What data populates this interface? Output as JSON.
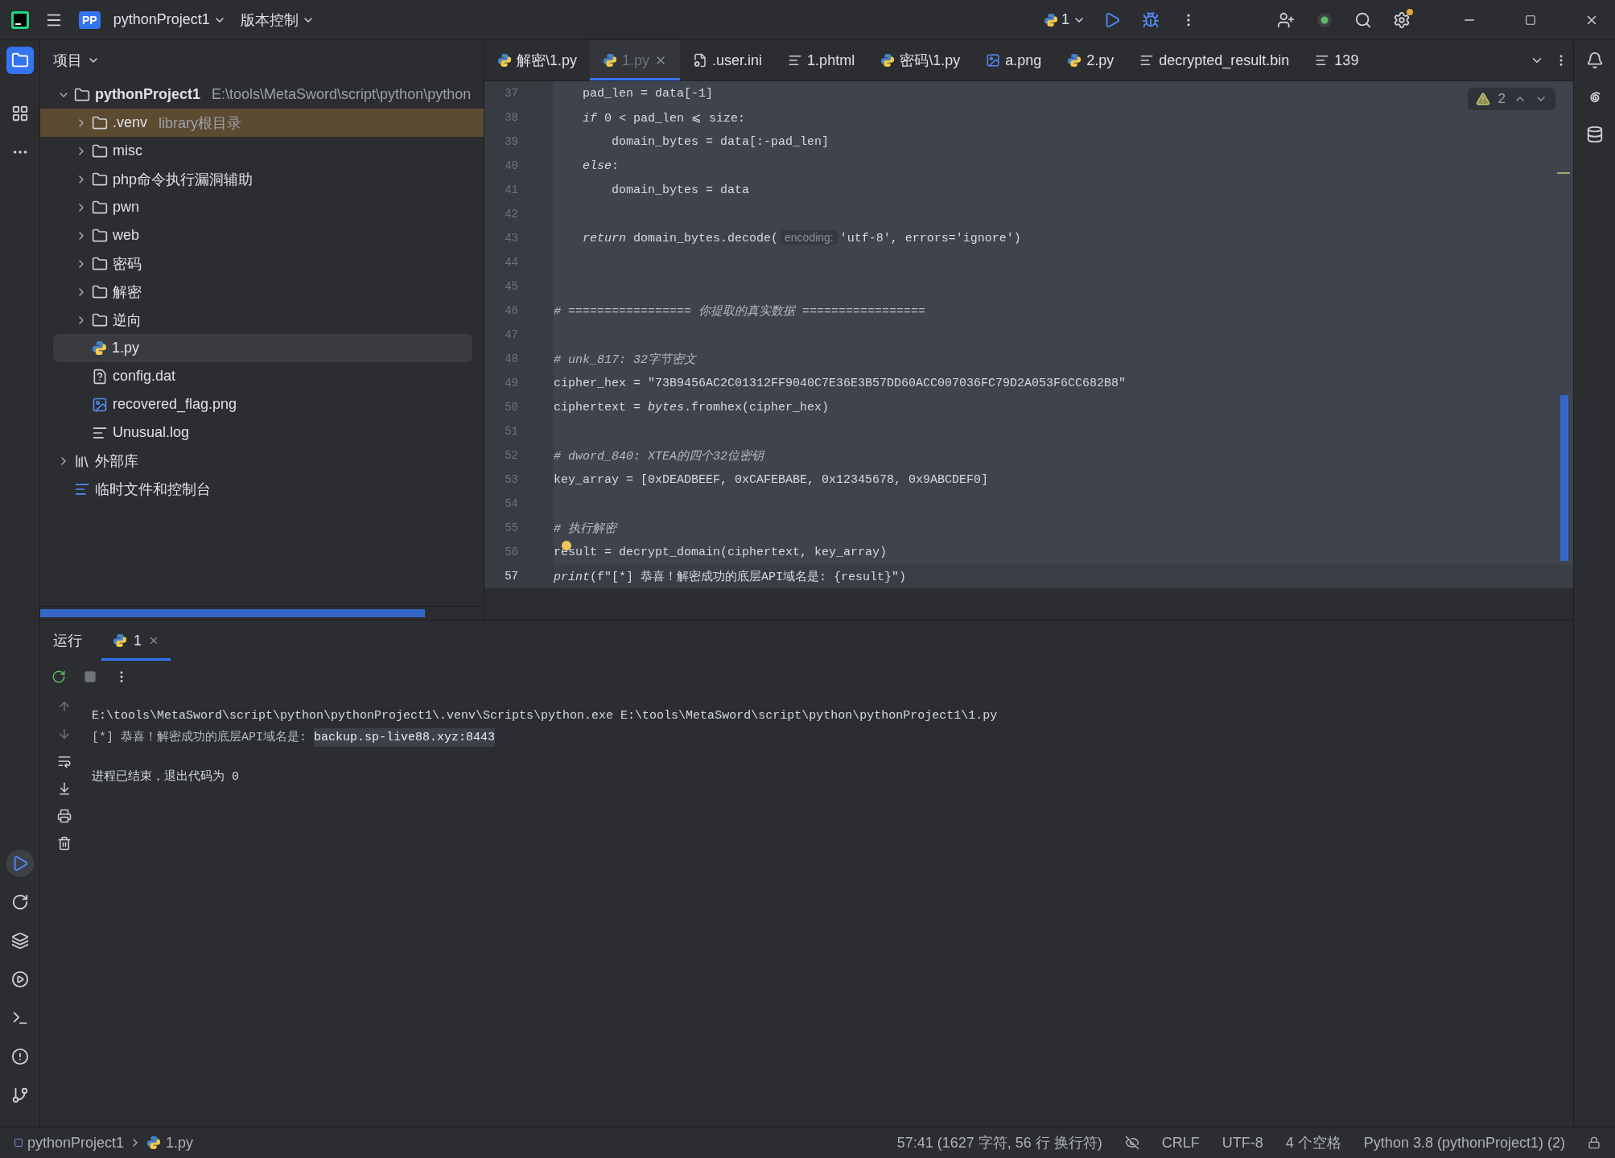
{
  "title_bar": {
    "project_badge": "PP",
    "project": "pythonProject1",
    "vcs": "版本控制",
    "run_config": "1"
  },
  "project_panel": {
    "title": "项目",
    "tree": [
      {
        "name": "pythonProject1",
        "path": "E:\\tools\\MetaSword\\script\\python\\python",
        "kind": "folder",
        "expanded": true,
        "selected": false,
        "children": [
          {
            "name": ".venv",
            "note": "library根目录",
            "kind": "library_root",
            "expanded": false,
            "selected": false
          },
          {
            "name": "misc",
            "kind": "folder",
            "expanded": false,
            "selected": false
          },
          {
            "name": "php命令执行漏洞辅助",
            "kind": "folder",
            "expanded": false,
            "selected": false
          },
          {
            "name": "pwn",
            "kind": "folder",
            "expanded": false,
            "selected": false
          },
          {
            "name": "web",
            "kind": "folder",
            "expanded": false,
            "selected": false
          },
          {
            "name": "密码",
            "kind": "folder",
            "expanded": false,
            "selected": false
          },
          {
            "name": "解密",
            "kind": "folder",
            "expanded": false,
            "selected": false
          },
          {
            "name": "逆向",
            "kind": "folder",
            "expanded": false,
            "selected": false
          },
          {
            "name": "1.py",
            "kind": "python",
            "selected": true
          },
          {
            "name": "config.dat",
            "kind": "unknown",
            "selected": false
          },
          {
            "name": "recovered_flag.png",
            "kind": "image",
            "selected": false
          },
          {
            "name": "Unusual.log",
            "kind": "text",
            "selected": false
          }
        ]
      },
      {
        "name": "外部库",
        "kind": "library",
        "expanded": false,
        "selected": false
      },
      {
        "name": "临时文件和控制台",
        "kind": "scratches",
        "selected": false
      }
    ]
  },
  "editor": {
    "tabs": [
      {
        "label": "解密\\1.py",
        "kind": "python",
        "selected": false
      },
      {
        "label": "1.py",
        "kind": "python",
        "selected": true
      },
      {
        "label": ".user.ini",
        "kind": "config",
        "selected": false
      },
      {
        "label": "1.phtml",
        "kind": "text",
        "selected": false
      },
      {
        "label": "密码\\1.py",
        "kind": "python",
        "selected": false
      },
      {
        "label": "a.png",
        "kind": "image",
        "selected": false
      },
      {
        "label": "2.py",
        "kind": "python",
        "selected": false
      },
      {
        "label": "decrypted_result.bin",
        "kind": "text",
        "selected": false
      },
      {
        "label": "139",
        "kind": "text",
        "selected": false
      }
    ],
    "inspection": {
      "warnings": "2"
    },
    "lines": [
      {
        "number": "37",
        "current": false,
        "segments": [
          {
            "kind": "plain",
            "text": "    pad_len = data[-1]"
          }
        ]
      },
      {
        "number": "38",
        "current": false,
        "segments": [
          {
            "kind": "keyword",
            "text": "    if"
          },
          {
            "kind": "plain",
            "text": " 0 < pad_len ⩽ size:"
          }
        ]
      },
      {
        "number": "39",
        "current": false,
        "segments": [
          {
            "kind": "plain",
            "text": "        domain_bytes = data[:-pad_len]"
          }
        ]
      },
      {
        "number": "40",
        "current": false,
        "segments": [
          {
            "kind": "keyword",
            "text": "    else"
          },
          {
            "kind": "plain",
            "text": ":"
          }
        ]
      },
      {
        "number": "41",
        "current": false,
        "segments": [
          {
            "kind": "plain",
            "text": "        domain_bytes = data"
          }
        ]
      },
      {
        "number": "42",
        "current": false
      },
      {
        "number": "43",
        "current": false,
        "segments": [
          {
            "kind": "keyword",
            "text": "    return"
          },
          {
            "kind": "plain",
            "text": " domain_bytes.decode("
          },
          {
            "kind": "hint",
            "text": "encoding:"
          },
          {
            "kind": "plain",
            "text": "'utf-8', errors='ignore')"
          }
        ]
      },
      {
        "number": "44",
        "current": false
      },
      {
        "number": "45",
        "current": false
      },
      {
        "number": "46",
        "current": false,
        "segments": [
          {
            "kind": "comment",
            "text": "# ================= 你提取的真实数据 ================="
          }
        ]
      },
      {
        "number": "47",
        "current": false
      },
      {
        "number": "48",
        "current": false,
        "segments": [
          {
            "kind": "comment",
            "text": "# unk_817: 32字节密文"
          }
        ]
      },
      {
        "number": "49",
        "current": false,
        "segments": [
          {
            "kind": "plain",
            "text": "cipher_hex = \"73B9456AC2C01312FF9040C7E36E3B57DD60ACC007036FC79D2A053F6CC682B8\""
          }
        ]
      },
      {
        "number": "50",
        "current": false,
        "segments": [
          {
            "kind": "plain",
            "text": "ciphertext = "
          },
          {
            "kind": "keyword",
            "text": "bytes"
          },
          {
            "kind": "plain",
            "text": ".fromhex(cipher_hex)"
          }
        ]
      },
      {
        "number": "51",
        "current": false
      },
      {
        "number": "52",
        "current": false,
        "segments": [
          {
            "kind": "comment",
            "text": "# dword_840: XTEA的四个32位密钥"
          }
        ]
      },
      {
        "number": "53",
        "current": false,
        "segments": [
          {
            "kind": "plain",
            "text": "key_array = [0xDEADBEEF, 0xCAFEBABE, 0x12345678, 0x9ABCDEF0]"
          }
        ]
      },
      {
        "number": "54",
        "current": false
      },
      {
        "number": "55",
        "current": false,
        "segments": [
          {
            "kind": "comment",
            "text": "# 执行解密"
          }
        ]
      },
      {
        "number": "56",
        "current": false,
        "bulb": true,
        "segments": [
          {
            "kind": "plain",
            "text": "result = decrypt_domain(ciphertext, key_array)"
          }
        ]
      },
      {
        "number": "57",
        "current": true,
        "segments": [
          {
            "kind": "keyword",
            "text": "print"
          },
          {
            "kind": "plain",
            "text": "(f\"[*] 恭喜！解密成功的底层API域名是: {result}\")"
          }
        ]
      }
    ]
  },
  "run_panel": {
    "title": "运行",
    "tabs": [
      {
        "label": "1",
        "selected": true
      }
    ],
    "console": [
      {
        "kind": "command",
        "text": "E:\\tools\\MetaSword\\script\\python\\pythonProject1\\.venv\\Scripts\\python.exe E:\\tools\\MetaSword\\script\\python\\pythonProject1\\1.py"
      },
      {
        "kind": "output",
        "text": "[*] 恭喜！解密成功的底层API域名是: ",
        "highlight": "backup.sp-live88.xyz:8443"
      },
      {
        "kind": "exit",
        "text": "进程已结束，退出代码为 0"
      }
    ]
  },
  "status_bar": {
    "breadcrumbs": [
      {
        "label": "pythonProject1",
        "kind": "module"
      },
      {
        "label": "1.py",
        "kind": "python"
      }
    ],
    "position": "57:41 (1627 字符, 56 行 换行符)",
    "items": [
      "CRLF",
      "UTF-8",
      "4 个空格",
      "Python 3.8 (pythonProject1) (2)"
    ]
  }
}
